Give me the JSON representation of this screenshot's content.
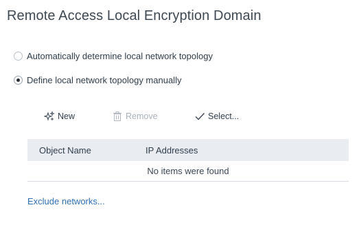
{
  "title": "Remote Access Local Encryption Domain",
  "topology": {
    "options": [
      {
        "label": "Automatically determine local network topology",
        "selected": false
      },
      {
        "label": "Define local network topology manually",
        "selected": true
      }
    ]
  },
  "toolbar": {
    "new_label": "New",
    "new_icon": "sparkle-icon",
    "remove_label": "Remove",
    "remove_icon": "trash-icon",
    "remove_enabled": false,
    "select_label": "Select...",
    "select_icon": "checkmark-icon"
  },
  "table": {
    "columns": [
      "Object Name",
      "IP Addresses"
    ],
    "rows": [],
    "empty_text": "No items were found"
  },
  "exclude_link": "Exclude networks...",
  "colors": {
    "link": "#2f6fb3",
    "header_bg": "#e9edf2",
    "disabled": "#a8b0b8"
  }
}
